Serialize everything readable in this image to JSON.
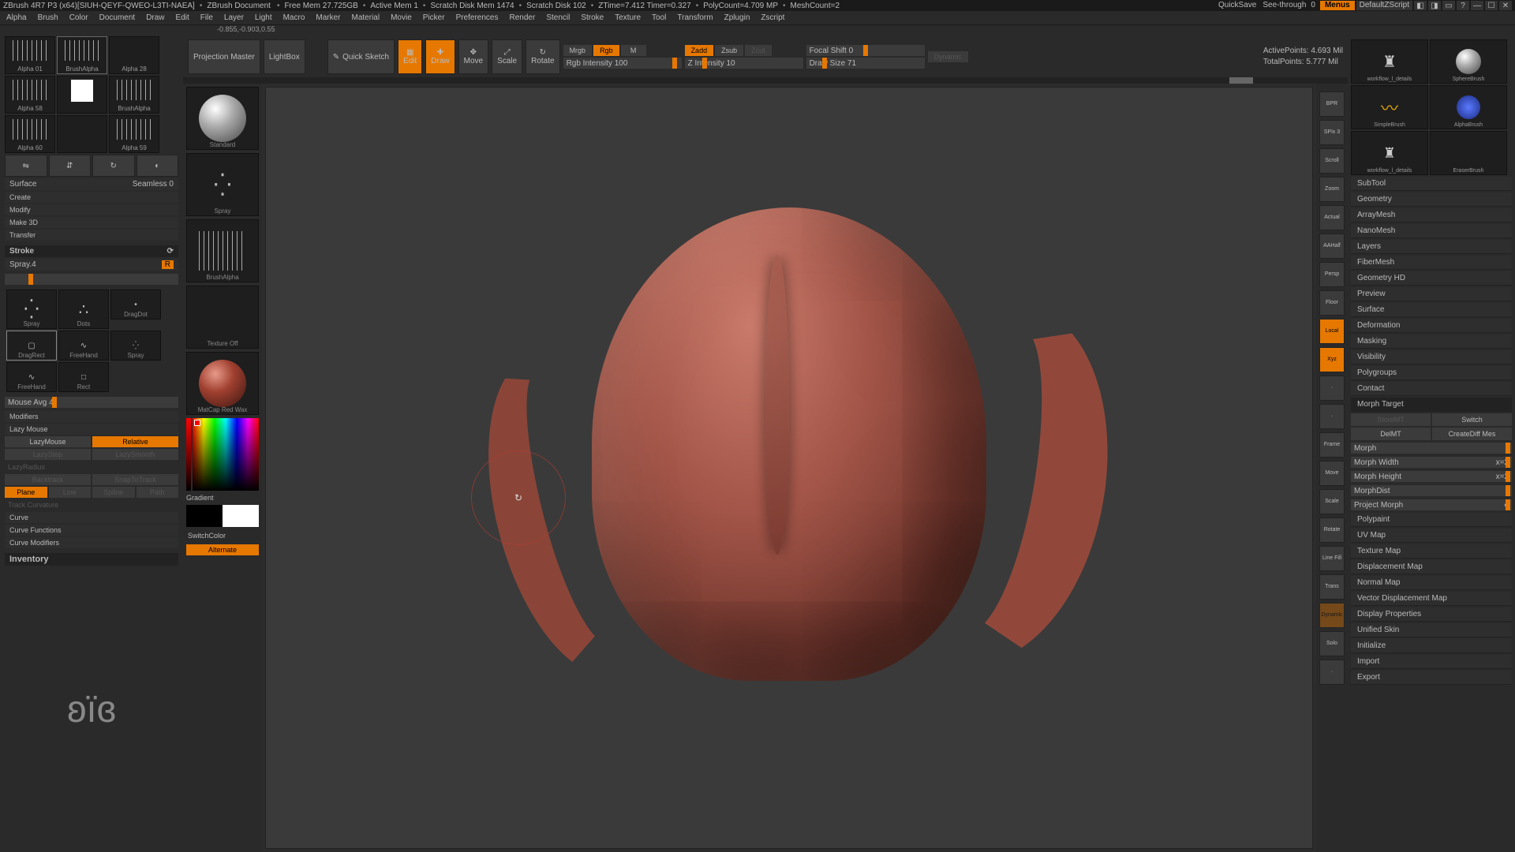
{
  "titlebar": {
    "app": "ZBrush 4R7 P3 (x64)[SIUH-QEYF-QWEO-L3TI-NAEA]",
    "doc": "ZBrush Document",
    "stats": [
      "Free Mem 27.725GB",
      "Active Mem 1",
      "Scratch Disk Mem 1474",
      "Scratch Disk 102",
      "ZTime=7.412 Timer=0.327",
      "PolyCount=4.709 MP",
      "MeshCount=2"
    ],
    "quicksave": "QuickSave",
    "seethrough": "See-through",
    "seethrough_val": "0",
    "menus": "Menus",
    "defaultscript": "DefaultZScript"
  },
  "menubar": [
    "Alpha",
    "Brush",
    "Color",
    "Document",
    "Draw",
    "Edit",
    "File",
    "Layer",
    "Light",
    "Macro",
    "Marker",
    "Material",
    "Movie",
    "Picker",
    "Preferences",
    "Render",
    "Stencil",
    "Stroke",
    "Texture",
    "Tool",
    "Transform",
    "Zplugin",
    "Zscript"
  ],
  "coord": "-0.855,-0.903,0.55",
  "alphas": [
    {
      "label": "Alpha 01",
      "kind": "brushAlpha"
    },
    {
      "label": "BrushAlpha",
      "kind": "lines",
      "sel": true
    },
    {
      "label": "Alpha 28",
      "kind": "blank"
    },
    {
      "label": "Alpha 58",
      "kind": "lines"
    },
    {
      "label": "",
      "kind": "swatch"
    },
    {
      "label": "BrushAlpha",
      "kind": "lines"
    },
    {
      "label": "Alpha 60",
      "kind": "lines"
    },
    {
      "label": "",
      "kind": "blank"
    },
    {
      "label": "Alpha 59",
      "kind": "lines"
    }
  ],
  "alphaops": {
    "row": [
      "Flip H",
      "Flip V",
      "Rotate",
      "Invers"
    ],
    "surface": "Surface",
    "seamless": "Seamless 0",
    "list": [
      "Create",
      "Modify",
      "Make 3D",
      "Transfer"
    ]
  },
  "stroke": {
    "header": "Stroke",
    "spray": "Spray.4",
    "r": "R",
    "thumbs": [
      {
        "l": "Spray"
      },
      {
        "l": "Dots"
      },
      {
        "l": "DragDot"
      },
      {
        "l": "DragRect",
        "sel": true
      },
      {
        "l": "FreeHand"
      },
      {
        "l": "Spray"
      },
      {
        "l": "FreeHand"
      },
      {
        "l": "Rect"
      }
    ],
    "mouseavg": "Mouse Avg 4",
    "modifiers": "Modifiers",
    "lazymouse": "Lazy Mouse",
    "lazymouse_btn": "LazyMouse",
    "relative": "Relative",
    "lazystep": "LazyStep",
    "lazysmooth": "LazySmooth",
    "lazyradius": "LazyRadius",
    "backtrack": "Backtrack",
    "snap": "SnapToTrack",
    "tracks": [
      "Plane",
      "Line",
      "Spline",
      "Path"
    ],
    "trackcurv": "Track Curvature",
    "curve": "Curve",
    "curvefn": "Curve Functions",
    "curvemod": "Curve Modifiers",
    "inventory": "Inventory"
  },
  "palette": {
    "brush": "Standard",
    "stroke": "Spray",
    "alpha": "BrushAlpha",
    "texture": "Texture Off",
    "material": "MatCap Red Wax",
    "gradient": "Gradient",
    "switch": "SwitchColor",
    "alternate": "Alternate"
  },
  "top": {
    "projection": "Projection Master",
    "lightbox": "LightBox",
    "quick": "Quick Sketch",
    "edit": "Edit",
    "draw": "Draw",
    "move": "Move",
    "scale": "Scale",
    "rotate": "Rotate",
    "mrgb": "Mrgb",
    "rgb": "Rgb",
    "m": "M",
    "rgbint": "Rgb Intensity 100",
    "zadd": "Zadd",
    "zsub": "Zsub",
    "zcut": "Zcut",
    "zint": "Z Intensity 10",
    "focal": "Focal Shift 0",
    "drawsize": "Draw Size 71",
    "dynamic": "Dynamic",
    "active": "ActivePoints:",
    "active_v": "4.693 Mil",
    "total": "TotalPoints:",
    "total_v": "5.777 Mil"
  },
  "toolstrip": [
    "BPR",
    "SPix 3",
    "Scroll",
    "Zoom",
    "Actual",
    "AAHalf",
    "Persp",
    "Floor",
    "Local",
    "Xyz",
    "·",
    "·",
    "Frame",
    "Move",
    "Scale",
    "Rotate",
    "Line Fill",
    "Trans",
    "Dynamic",
    "Solo",
    "·"
  ],
  "tools": [
    {
      "l": "workflow_l_details",
      "icon": "bust"
    },
    {
      "l": "SphereBrush",
      "icon": "sphere"
    },
    {
      "l": "SimpleBrush",
      "icon": "curve"
    },
    {
      "l": "AlphaBrush",
      "icon": "sphere-b"
    },
    {
      "l": "workflow_l_details",
      "icon": "bust2"
    },
    {
      "l": "EraserBrush",
      "icon": "blank"
    }
  ],
  "rp_sections": [
    "SubTool",
    "Geometry",
    "ArrayMesh",
    "NanoMesh",
    "Layers",
    "FiberMesh",
    "Geometry HD",
    "Preview",
    "Surface",
    "Deformation",
    "Masking",
    "Visibility",
    "Polygroups",
    "Contact"
  ],
  "morph": {
    "header": "Morph Target",
    "storemt": "StoreMT",
    "switch": "Switch",
    "delmt": "DelMT",
    "creatediff": "CreateDiff Mes",
    "morph": "Morph",
    "width": "Morph Width",
    "widthv": "x=2",
    "height": "Morph Height",
    "heightv": "x=2",
    "dist": "MorphDist",
    "proj": "Project Morph"
  },
  "rp_sections2": [
    "Polypaint",
    "UV Map",
    "Texture Map",
    "Displacement Map",
    "Normal Map",
    "Vector Displacement Map",
    "Display Properties",
    "Unified Skin",
    "Initialize",
    "Import",
    "Export"
  ]
}
